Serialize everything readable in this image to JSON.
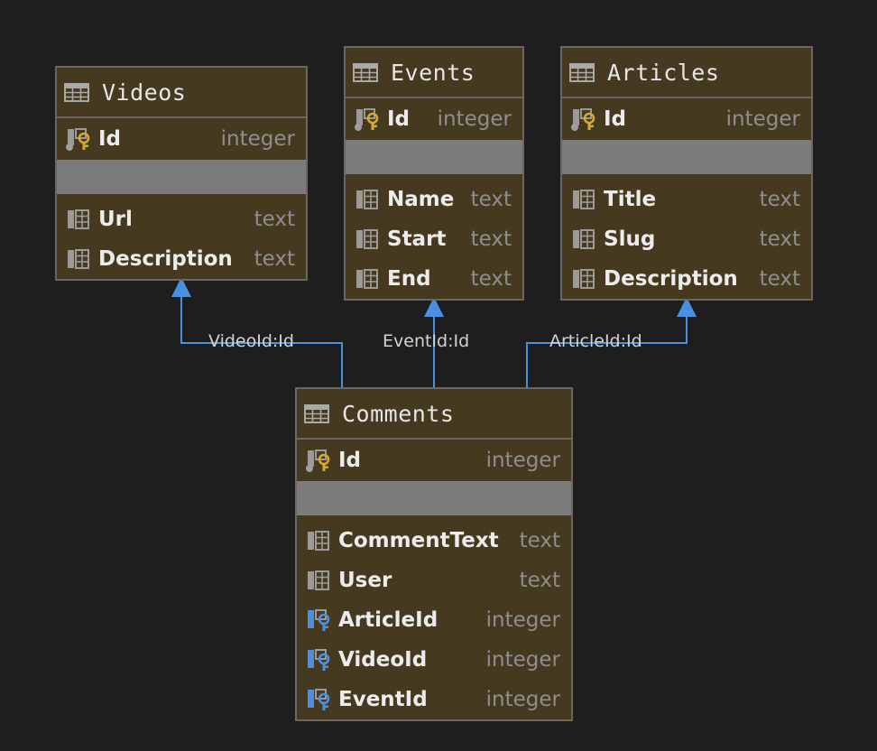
{
  "tables": {
    "videos": {
      "name": "Videos",
      "columns": [
        {
          "name": "Id",
          "type": "integer",
          "key": "primary"
        },
        {
          "name": "Url",
          "type": "text",
          "key": "none"
        },
        {
          "name": "Description",
          "type": "text",
          "key": "none"
        }
      ]
    },
    "events": {
      "name": "Events",
      "columns": [
        {
          "name": "Id",
          "type": "integer",
          "key": "primary"
        },
        {
          "name": "Name",
          "type": "text",
          "key": "none"
        },
        {
          "name": "Start",
          "type": "text",
          "key": "none"
        },
        {
          "name": "End",
          "type": "text",
          "key": "none"
        }
      ]
    },
    "articles": {
      "name": "Articles",
      "columns": [
        {
          "name": "Id",
          "type": "integer",
          "key": "primary"
        },
        {
          "name": "Title",
          "type": "text",
          "key": "none"
        },
        {
          "name": "Slug",
          "type": "text",
          "key": "none"
        },
        {
          "name": "Description",
          "type": "text",
          "key": "none"
        }
      ]
    },
    "comments": {
      "name": "Comments",
      "columns": [
        {
          "name": "Id",
          "type": "integer",
          "key": "primary"
        },
        {
          "name": "CommentText",
          "type": "text",
          "key": "none"
        },
        {
          "name": "User",
          "type": "text",
          "key": "none"
        },
        {
          "name": "ArticleId",
          "type": "integer",
          "key": "foreign"
        },
        {
          "name": "VideoId",
          "type": "integer",
          "key": "foreign"
        },
        {
          "name": "EventId",
          "type": "integer",
          "key": "foreign"
        }
      ]
    }
  },
  "relations": [
    {
      "label": "VideoId:Id",
      "from": "Comments",
      "to": "Videos"
    },
    {
      "label": "EventId:Id",
      "from": "Comments",
      "to": "Events"
    },
    {
      "label": "ArticleId:Id",
      "from": "Comments",
      "to": "Articles"
    }
  ],
  "colors": {
    "background": "#1e1e1f",
    "table_fill": "#453a20",
    "table_border": "#6c6660",
    "edge": "#4a90e2",
    "primary_key": "#d6a832",
    "foreign_key": "#4a8fe2"
  },
  "icons": {
    "table": "table-grid-icon",
    "primary_key": "primary-key-icon",
    "foreign_key": "foreign-key-icon",
    "column": "column-icon"
  }
}
